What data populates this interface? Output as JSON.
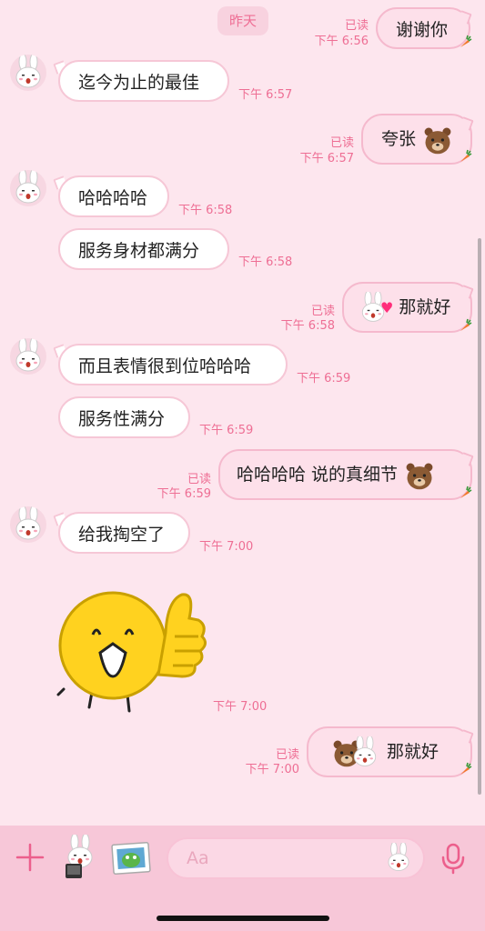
{
  "date_divider": "昨天",
  "messages": [
    {
      "side": "out",
      "text": "谢谢你",
      "read": "已读",
      "time": "下午 6:56"
    },
    {
      "side": "in",
      "text": "迄今为止的最佳",
      "time": "下午 6:57"
    },
    {
      "side": "out",
      "text": "夸张",
      "read": "已读",
      "time": "下午 6:57"
    },
    {
      "side": "in",
      "text": "哈哈哈哈",
      "time": "下午 6:58"
    },
    {
      "side": "in",
      "text": "服务身材都满分",
      "time": "下午 6:58"
    },
    {
      "side": "out",
      "text": "那就好",
      "read": "已读",
      "time": "下午 6:58"
    },
    {
      "side": "in",
      "text": "而且表情很到位哈哈哈",
      "time": "下午 6:59"
    },
    {
      "side": "in",
      "text": "服务性满分",
      "time": "下午 6:59"
    },
    {
      "side": "out",
      "text": "哈哈哈哈 说的真细节",
      "read": "已读",
      "time": "下午 6:59"
    },
    {
      "side": "in",
      "text": "给我掏空了",
      "time": "下午 7:00"
    },
    {
      "side": "in",
      "sticker": "yellow-thumbs-up-sticker",
      "time": "下午 7:00"
    },
    {
      "side": "out",
      "text": "那就好",
      "read": "已读",
      "time": "下午 7:00"
    }
  ],
  "input": {
    "placeholder": "Aa"
  },
  "colors": {
    "background": "#fde6ee",
    "accent": "#ee6e94",
    "bubble_in": "#ffffff",
    "bubble_out": "#fde0ea",
    "toolbar": "#f7c7d8"
  },
  "icons": {
    "add": "plus-icon",
    "sticker_shortcut": "bunny-sticker-icon",
    "gallery": "photo-icon",
    "emoji": "bunny-emoji-icon",
    "voice": "microphone-icon",
    "delivered": "carrot-icon"
  }
}
